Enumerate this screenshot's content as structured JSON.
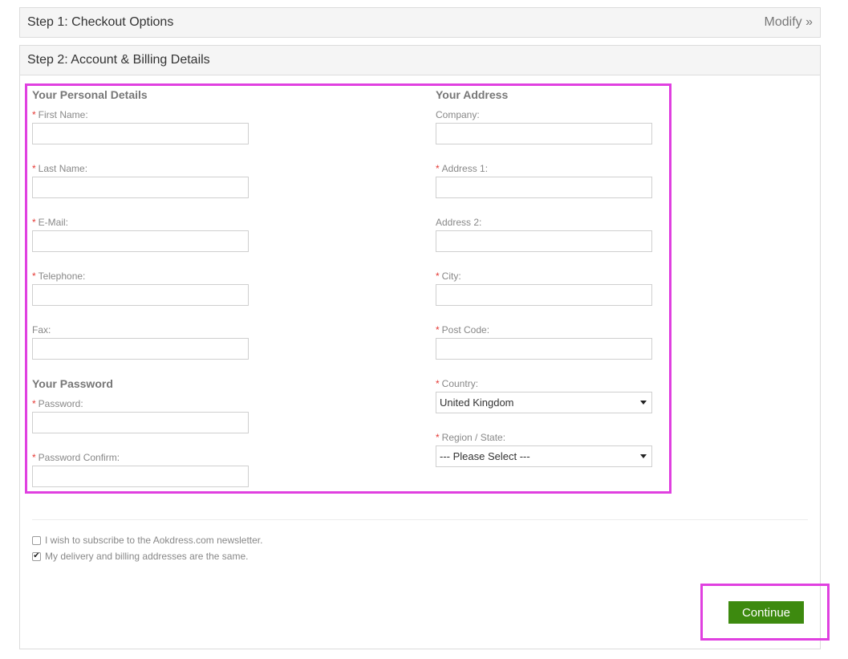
{
  "step1": {
    "title": "Step 1: Checkout Options",
    "modify": "Modify »"
  },
  "step2": {
    "title": "Step 2: Account & Billing Details"
  },
  "personal": {
    "title": "Your Personal Details",
    "first_name": {
      "label": "First Name:",
      "value": ""
    },
    "last_name": {
      "label": "Last Name:",
      "value": ""
    },
    "email": {
      "label": "E-Mail:",
      "value": ""
    },
    "telephone": {
      "label": "Telephone:",
      "value": ""
    },
    "fax": {
      "label": "Fax:",
      "value": ""
    }
  },
  "password": {
    "title": "Your Password",
    "password": {
      "label": "Password:",
      "value": ""
    },
    "confirm": {
      "label": "Password Confirm:",
      "value": ""
    }
  },
  "address": {
    "title": "Your Address",
    "company": {
      "label": "Company:",
      "value": ""
    },
    "address1": {
      "label": "Address 1:",
      "value": ""
    },
    "address2": {
      "label": "Address 2:",
      "value": ""
    },
    "city": {
      "label": "City:",
      "value": ""
    },
    "postcode": {
      "label": "Post Code:",
      "value": ""
    },
    "country": {
      "label": "Country:",
      "selected": "United Kingdom"
    },
    "region": {
      "label": "Region / State:",
      "selected": "--- Please Select ---"
    }
  },
  "required_marker": "*",
  "options": {
    "newsletter": {
      "label": "I wish to subscribe to the Aokdress.com newsletter.",
      "checked": false
    },
    "same_address": {
      "label": "My delivery and billing addresses are the same.",
      "checked": true
    }
  },
  "continue_label": "Continue",
  "colors": {
    "accent_green": "#3d8a0f",
    "highlight": "#e040e0",
    "required": "#e53935"
  }
}
